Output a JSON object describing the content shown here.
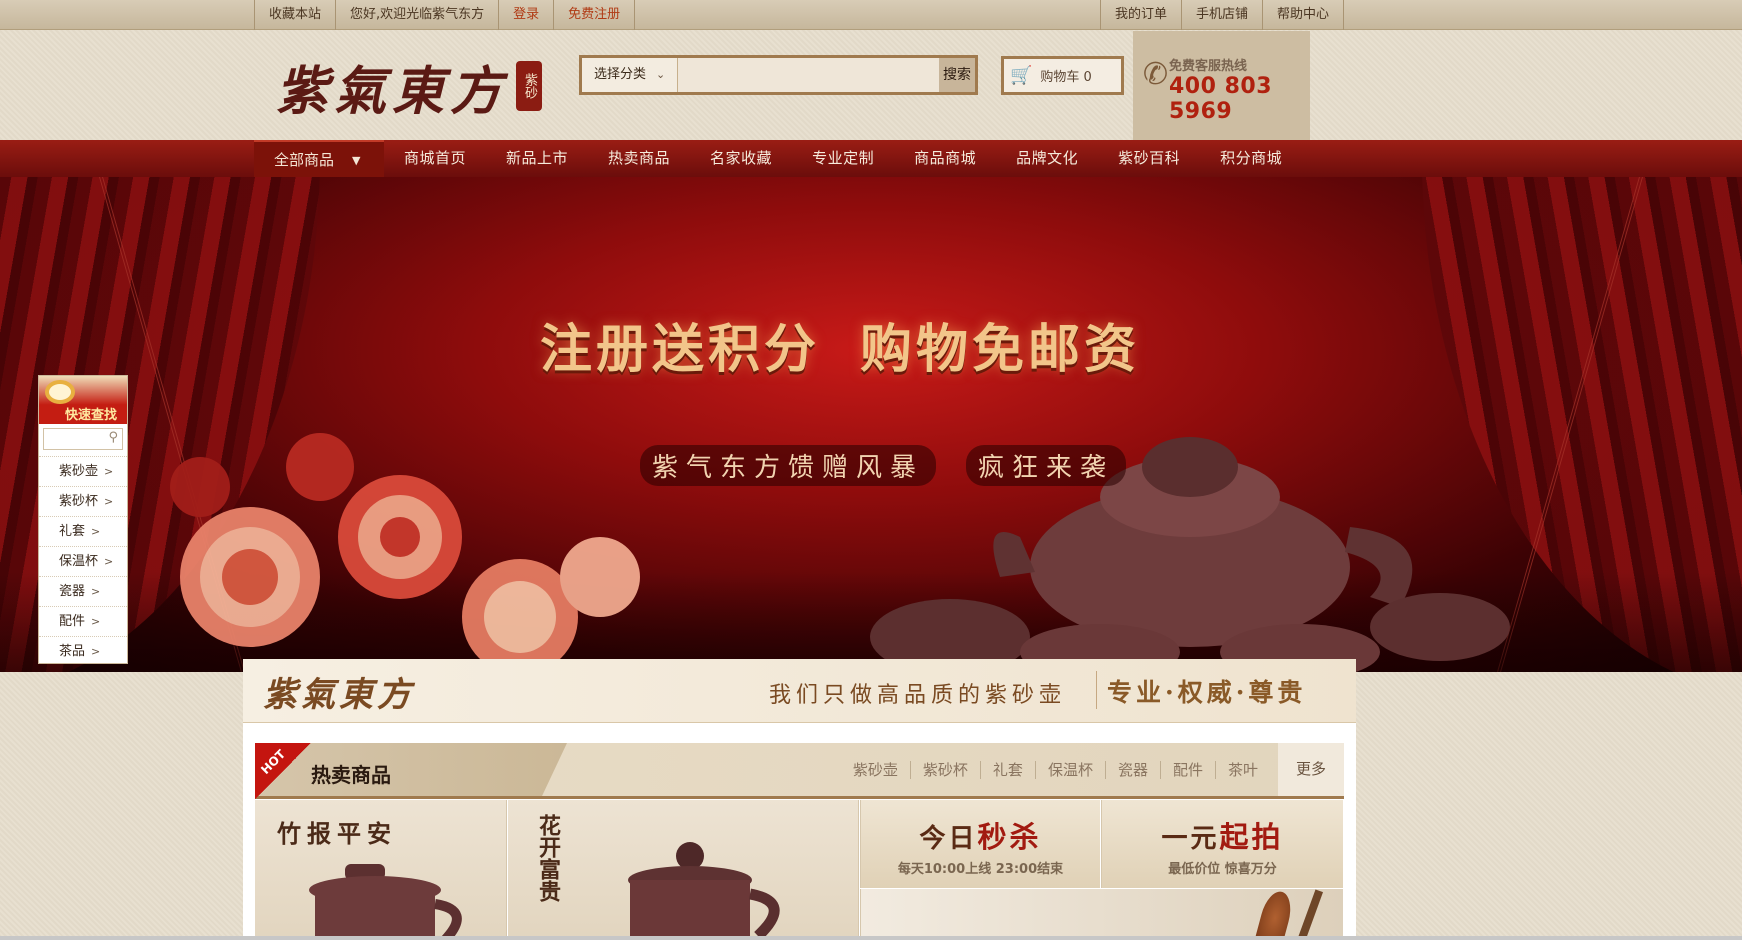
{
  "topbar": {
    "left": [
      "收藏本站",
      "您好,欢迎光临紫气东方",
      "登录",
      "免费注册"
    ],
    "right": [
      "我的订单",
      "手机店铺",
      "帮助中心"
    ]
  },
  "header": {
    "logo_text": "紫氣東方",
    "logo_seal": "紫砂",
    "search": {
      "category": "选择分类",
      "placeholder": "",
      "button": "搜索"
    },
    "cart": {
      "label": "购物车 0"
    },
    "hotline": {
      "label": "免费客服热线",
      "number": "400 803 5969"
    }
  },
  "nav": {
    "all": "全部商品",
    "items": [
      "商城首页",
      "新品上市",
      "热卖商品",
      "名家收藏",
      "专业定制",
      "商品商城",
      "品牌文化",
      "紫砂百科",
      "积分商城"
    ]
  },
  "banner": {
    "headline_1": "注册送积分",
    "headline_2": "购物免邮资",
    "sub_1": "紫气东方馈赠风暴",
    "sub_2": "疯狂来袭"
  },
  "quickfind": {
    "title": "快速查找",
    "items": [
      "紫砂壶",
      "紫砂杯",
      "礼套",
      "保温杯",
      "瓷器",
      "配件",
      "茶品"
    ],
    "arrow": ">"
  },
  "slogan": {
    "brand": "紫氣東方",
    "motto": "我们只做高品质的紫砂壶",
    "tagline": "专业·权威·尊贵"
  },
  "hot": {
    "badge": "HOT",
    "title": "热卖商品",
    "tabs": [
      "紫砂壶",
      "紫砂杯",
      "礼套",
      "保温杯",
      "瓷器",
      "配件",
      "茶叶"
    ],
    "more": "更多"
  },
  "tiles": {
    "t1": "竹报平安",
    "t2": "花开富贵"
  },
  "promos": {
    "p1_title_a": "今日",
    "p1_title_b": "秒杀",
    "p1_sub": "每天10:00上线 23:00结束",
    "p2_title_a": "一元",
    "p2_title_b": "起拍",
    "p2_sub": "最低价位 惊喜万分"
  },
  "colors": {
    "brand_red": "#9a1d14",
    "accent_gold": "#a07a4e",
    "hotline_red": "#b0210f"
  }
}
